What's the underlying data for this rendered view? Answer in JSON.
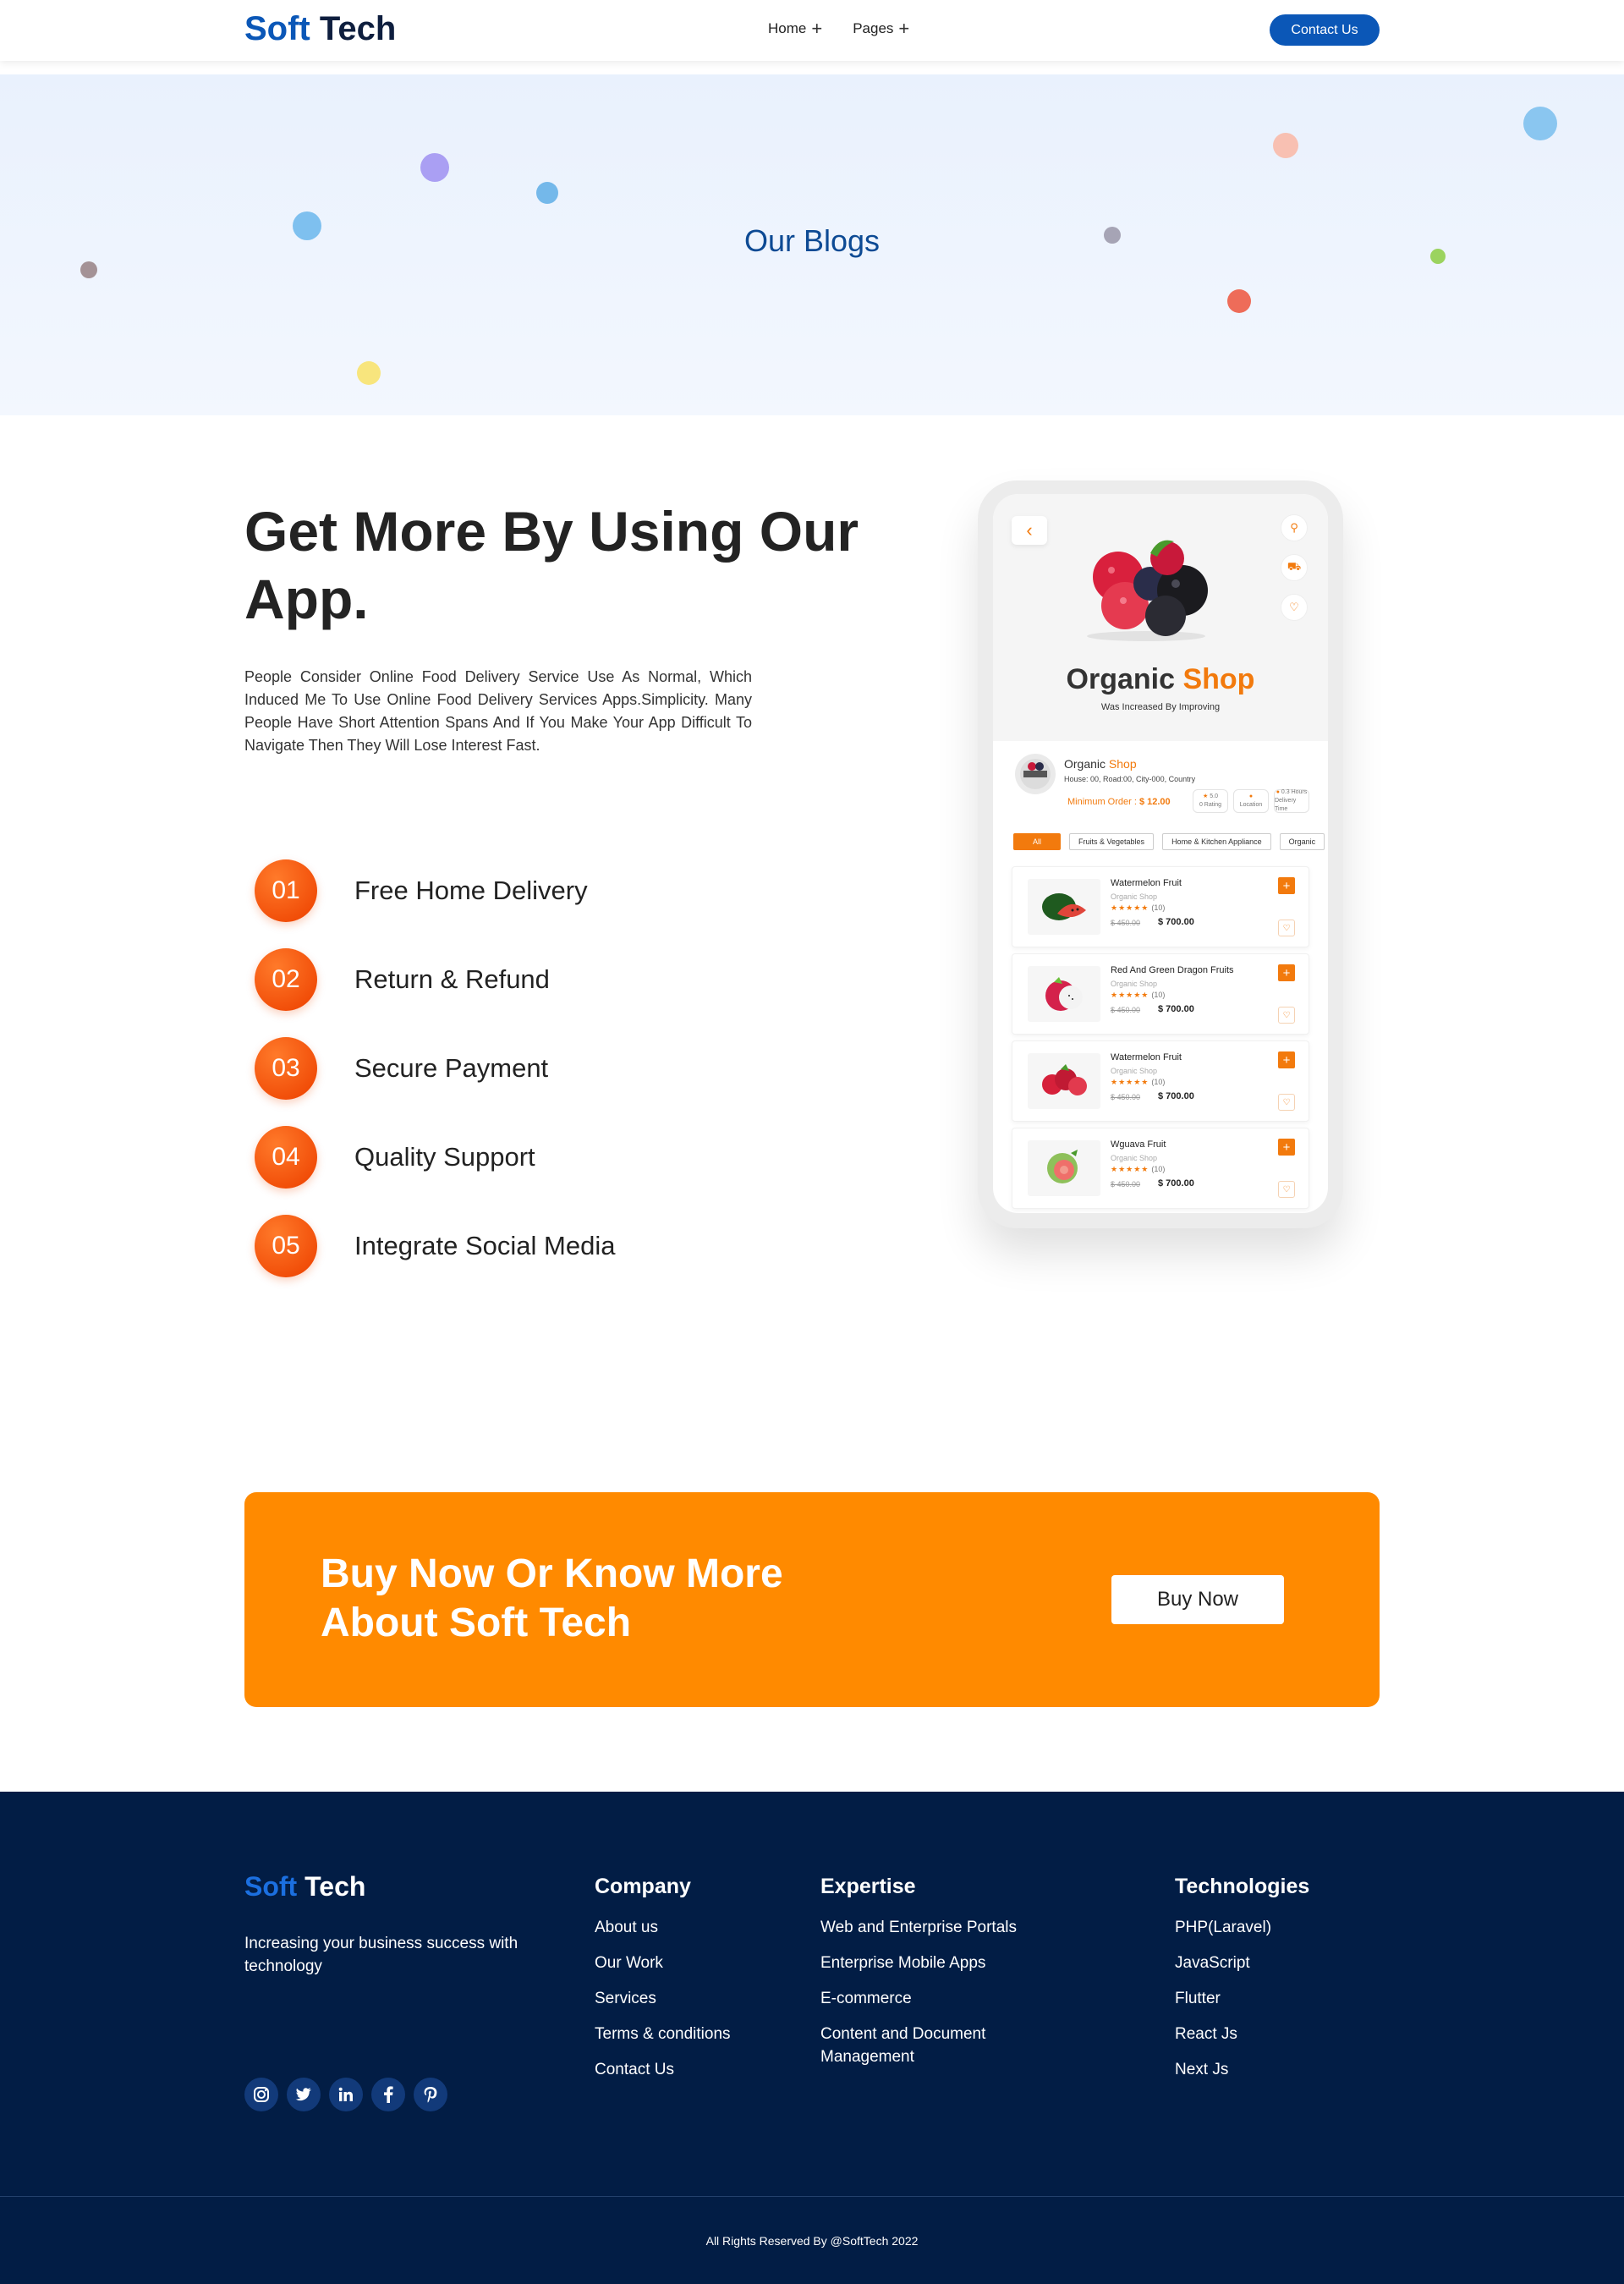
{
  "header": {
    "logo_part1": "Soft",
    "logo_part2": "Tech",
    "nav": [
      {
        "label": "Home",
        "icon": "plus-icon"
      },
      {
        "label": "Pages",
        "icon": "plus-icon"
      }
    ],
    "contact_label": "Contact Us"
  },
  "hero": {
    "title": "Our Blogs"
  },
  "app_section": {
    "title": "Get More By Using Our App.",
    "description": "People Consider Online Food Delivery Service Use As Normal, Which Induced Me To Use Online Food Delivery Services Apps.Simplicity. Many People Have Short Attention Spans And If You Make Your App Difficult To Navigate Then They Will Lose Interest Fast.",
    "features": [
      {
        "num": "01",
        "label": "Free Home Delivery"
      },
      {
        "num": "02",
        "label": "Return & Refund"
      },
      {
        "num": "03",
        "label": "Secure Payment"
      },
      {
        "num": "04",
        "label": "Quality Support"
      },
      {
        "num": "05",
        "label": "Integrate Social Media"
      }
    ]
  },
  "phone": {
    "shop_title_1": "Organic",
    "shop_title_2": "Shop",
    "shop_subtitle": "Was Increased By Improving",
    "store_name_1": "Organic",
    "store_name_2": "Shop",
    "store_address": "House: 00, Road:00, City-000, Country",
    "min_order_label": "Minimum Order :",
    "min_order_value": "$ 12.00",
    "stats": [
      {
        "icon": "★",
        "line1": "5.0",
        "line2": "0 Rating"
      },
      {
        "icon": "●",
        "line1": "",
        "line2": "Location"
      },
      {
        "icon": "●",
        "line1": "0.3 Hours",
        "line2": "Delivery Time"
      }
    ],
    "categories": [
      "All",
      "Fruits & Vegetables",
      "Home & Kitchen Appliance",
      "Organic"
    ],
    "products": [
      {
        "name": "Watermelon Fruit",
        "shop": "Organic Shop",
        "stars": "★★★★★",
        "count": "(10)",
        "old_price": "$ 450.00",
        "price": "$ 700.00"
      },
      {
        "name": "Red And Green Dragon Fruits",
        "shop": "Organic Shop",
        "stars": "★★★★★",
        "count": "(10)",
        "old_price": "$ 450.00",
        "price": "$ 700.00"
      },
      {
        "name": "Watermelon Fruit",
        "shop": "Organic Shop",
        "stars": "★★★★★",
        "count": "(10)",
        "old_price": "$ 450.00",
        "price": "$ 700.00"
      },
      {
        "name": "Wguava Fruit",
        "shop": "Organic Shop",
        "stars": "★★★★★",
        "count": "(10)",
        "old_price": "$ 450.00",
        "price": "$ 700.00"
      }
    ]
  },
  "cta": {
    "title": "Buy Now Or Know More About Soft Tech",
    "button": "Buy Now",
    "color": "#ff8a00"
  },
  "footer": {
    "logo_part1": "Soft",
    "logo_part2": "Tech",
    "tagline": "Increasing your business success with technology",
    "socials": [
      "instagram-icon",
      "twitter-icon",
      "linkedin-icon",
      "facebook-icon",
      "pinterest-icon"
    ],
    "columns": [
      {
        "title": "Company",
        "links": [
          "About us",
          "Our Work",
          "Services",
          "Terms & conditions",
          "Contact Us"
        ]
      },
      {
        "title": "Expertise",
        "links": [
          "Web and Enterprise Portals",
          "Enterprise Mobile Apps",
          "E-commerce",
          "Content and Document Management"
        ]
      },
      {
        "title": "Technologies",
        "links": [
          "PHP(Laravel)",
          "JavaScript",
          "Flutter",
          "React Js",
          "Next Js"
        ]
      }
    ],
    "copyright": "All Rights Reserved By @SoftTech 2022"
  },
  "colors": {
    "brand_blue": "#0b57b7",
    "accent_orange": "#f27a0d",
    "footer_bg": "#021d45"
  }
}
